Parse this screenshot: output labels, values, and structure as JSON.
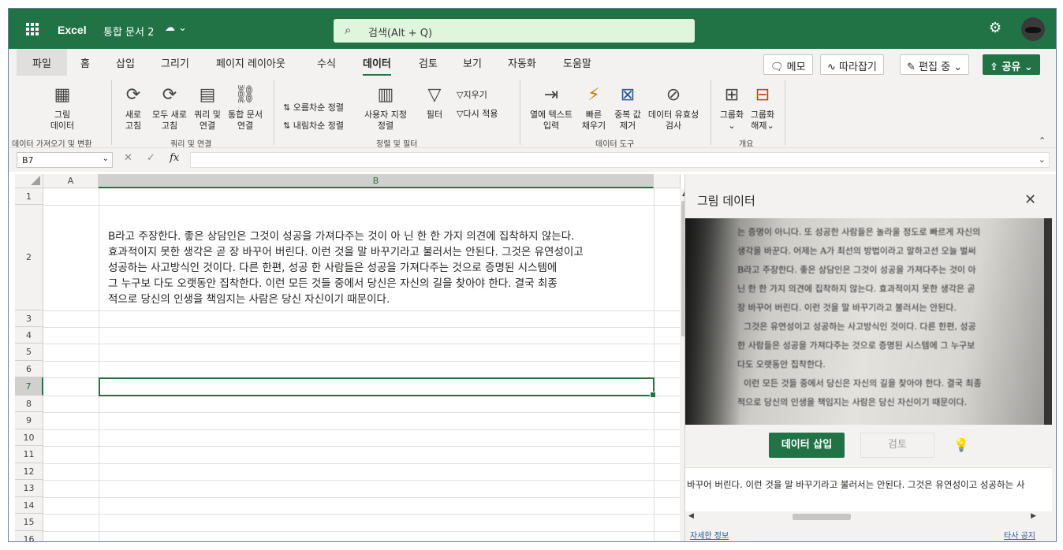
{
  "app": {
    "name": "Excel",
    "doc_title": "통합 문서 2",
    "doc_status_icon": "cloud-saved-icon",
    "doc_dropdown": "⌄"
  },
  "search": {
    "placeholder": "검색(Alt + Q)"
  },
  "tabs": [
    {
      "label": "파일"
    },
    {
      "label": "홈"
    },
    {
      "label": "삽입"
    },
    {
      "label": "그리기"
    },
    {
      "label": "페이지 레이아웃"
    },
    {
      "label": "수식"
    },
    {
      "label": "데이터"
    },
    {
      "label": "검토"
    },
    {
      "label": "보기"
    },
    {
      "label": "자동화"
    },
    {
      "label": "도움말"
    }
  ],
  "active_tab": "데이터",
  "top_buttons": {
    "memo": "메모",
    "track": "따라잡기",
    "editing": "편집 중",
    "share": "공유"
  },
  "ribbon": {
    "get_data": {
      "btn1": "그림",
      "btn1b": "데이터",
      "group": "데이터 가져오기 및 변환"
    },
    "queries": {
      "refresh": "새로",
      "refresh_b": "고침",
      "refresh_all": "모두 새로",
      "refresh_all_b": "고침",
      "queries": "쿼리 및",
      "queries_b": "연결",
      "workbook_links": "통합 문서",
      "workbook_links_b": "연결",
      "group": "쿼리 및 연결"
    },
    "sort": {
      "asc": "오름차순 정렬",
      "desc": "내림차순 정렬",
      "custom": "사용자 지정",
      "custom_b": "정렬",
      "filter": "필터",
      "clear": "지우기",
      "reapply": "다시 적용",
      "group": "정렬 및 필터"
    },
    "tools": {
      "text_to_col": "열에 텍스트",
      "text_to_col_b": "입력",
      "flash": "빠른",
      "flash_b": "채우기",
      "dup": "중복 값",
      "dup_b": "제거",
      "validation": "데이터 유효성",
      "validation_b": "검사",
      "group": "데이터 도구"
    },
    "outline": {
      "group_btn": "그룹화",
      "group_btn_b": "⌄",
      "ungroup": "그룹화",
      "ungroup_b": "해제⌄",
      "group": "개요"
    }
  },
  "formula_bar": {
    "name_box": "B7",
    "cancel": "✕",
    "confirm": "✓",
    "fx": "fx"
  },
  "grid": {
    "columns": [
      "A",
      "B"
    ],
    "rows": [
      "1",
      "2",
      "3",
      "4",
      "5",
      "6",
      "7",
      "8",
      "9",
      "10",
      "11",
      "12",
      "13",
      "14",
      "15",
      "16"
    ],
    "selected_cell": "B7",
    "cell_b2_lines": [
      "B라고 주장한다. 좋은 상담인은 그것이 성공을 가져다주는 것이 아 닌 한 한 가지 의견에 집착하지 않는다.",
      "효과적이지 못한 생각은 곧 장 바꾸어 버린다. 이런 것을 말 바꾸기라고 불러서는 안된다. 그것은 유연성이고",
      "성공하는 사고방식인 것이다. 다른 한편, 성공 한 사람들은 성공을 가져다주는 것으로 증명된 시스템에",
      "그 누구보 다도 오랫동안 집착한다. 이런 모든 것들 중에서 당신은 자신의 길을 찾아야 한다. 결국 최종",
      "적으로 당신의 인생을 책임지는 사람은 당신 자신이기 때문이다."
    ]
  },
  "pane": {
    "title": "그림 데이터",
    "photo_lines": [
      "는 증명이 아니다. 또 성공한 사람들은 놀라울 정도로 빠르게 자신의",
      "생각을 바꾼다. 어제는 A가 최선의 방법이라고 말하고선 오늘 벌써",
      "B라고 주장한다. 좋은 상담인은 그것이 성공을 가져다주는 것이 아",
      "닌 한 한 가지 의견에 집착하지 않는다. 효과적이지 못한 생각은 곧",
      "장 바꾸어 버린다. 이런 것을 말 바꾸기라고 불러서는 안된다.",
      "그것은 유연성이고 성공하는 사고방식인 것이다. 다른 한편, 성공",
      "한 사람들은 성공을 가져다주는 것으로 증명된 시스템에 그 누구보",
      "다도 오랫동안 집착한다.",
      "이런 모든 것들 중에서 당신은 자신의 길을 찾아야 한다. 결국 최종",
      "적으로 당신의 인생을 책임지는 사람은 당신 자신이기 때문이다."
    ],
    "insert_button": "데이터 삽입",
    "review_button": "검토",
    "text_preview": "바꾸어 버린다. 이런 것을 말 바꾸기라고 불러서는 안된다. 그것은 유연성이고 성공하는 사",
    "link_more": "자세한 정보",
    "link_disclaimer": "타사 공지"
  },
  "colors": {
    "brand": "#217346",
    "search_bg": "#dff6dd"
  }
}
